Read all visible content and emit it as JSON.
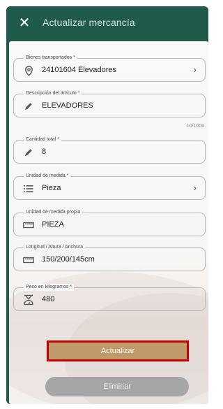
{
  "header": {
    "close_icon": "close-icon",
    "title": "Actualizar mercancía"
  },
  "form": {
    "bienes": {
      "label": "Bienes transportados *",
      "value": "24101604 Elevadores",
      "icon": "location-pin-icon"
    },
    "descripcion": {
      "label": "Descripción del artículo *",
      "value": "ELEVADORES",
      "counter": "10/1000",
      "icon": "pencil-icon"
    },
    "cantidad": {
      "label": "Cantidad total *",
      "value": "8",
      "icon": "pencil-icon"
    },
    "unidad": {
      "label": "Unidad de medida *",
      "value": "Pieza",
      "icon": "list-icon"
    },
    "unidad_propia": {
      "label": "Unidad de medida propia",
      "value": "PIEZA",
      "icon": "ruler-icon"
    },
    "dimensiones": {
      "label": "Longitud / Altura / Anchura",
      "value": "150/200/145cm",
      "icon": "ruler-icon"
    },
    "peso": {
      "label": "Peso en kilogramos *",
      "value": "480",
      "icon": "weight-scale-icon"
    }
  },
  "actions": {
    "update_label": "Actualizar",
    "delete_label": "Eliminar"
  },
  "colors": {
    "header_bg": "#1f5a4a",
    "update_bg": "#c19a6b",
    "update_border": "#c80000",
    "delete_bg": "#a6a6a6"
  }
}
